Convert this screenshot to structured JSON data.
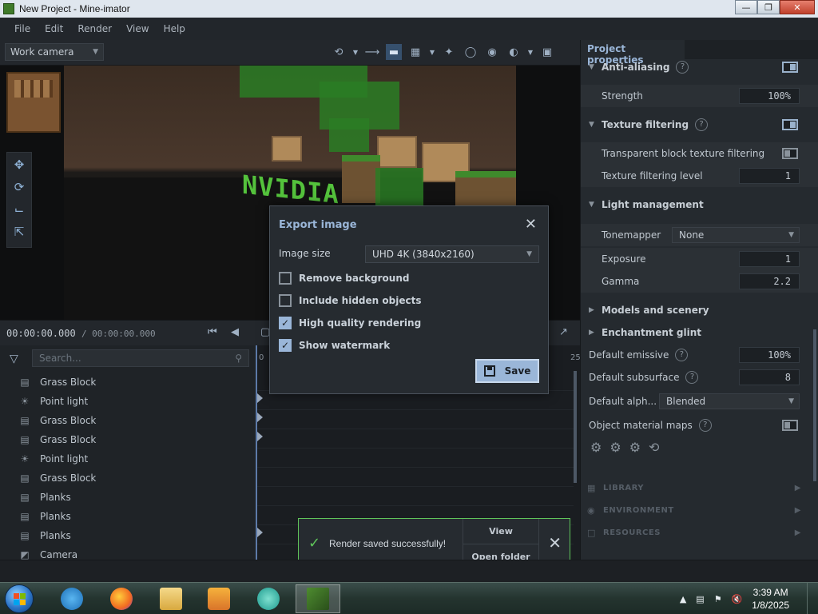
{
  "window": {
    "title": "New Project - Mine-imator"
  },
  "menu": [
    "File",
    "Edit",
    "Render",
    "View",
    "Help"
  ],
  "viewport_toolbar": {
    "camera": "Work camera"
  },
  "viewport": {
    "scene_text": "NVIDIA"
  },
  "timeline": {
    "current_time": "00:00:00.000",
    "total_time": "/ 00:00:00.000",
    "search_placeholder": "Search...",
    "ruler_start": "0",
    "ruler_end": "25",
    "items": [
      {
        "label": "Grass Block",
        "icon": "block-icon"
      },
      {
        "label": "Point light",
        "icon": "light-icon"
      },
      {
        "label": "Grass Block",
        "icon": "block-icon"
      },
      {
        "label": "Grass Block",
        "icon": "block-icon"
      },
      {
        "label": "Point light",
        "icon": "light-icon"
      },
      {
        "label": "Grass Block",
        "icon": "block-icon"
      },
      {
        "label": "Planks",
        "icon": "block-icon"
      },
      {
        "label": "Planks",
        "icon": "block-icon"
      },
      {
        "label": "Planks",
        "icon": "block-icon"
      },
      {
        "label": "Camera",
        "icon": "camera-icon"
      }
    ]
  },
  "properties": {
    "tab": "Project properties",
    "anti_aliasing": "Anti-aliasing",
    "strength_label": "Strength",
    "strength_value": "100%",
    "texture_filtering": "Texture filtering",
    "transparent_filtering": "Transparent block texture filtering",
    "filtering_level_label": "Texture filtering level",
    "filtering_level_value": "1",
    "light_management": "Light management",
    "tonemapper_label": "Tonemapper",
    "tonemapper_value": "None",
    "exposure_label": "Exposure",
    "exposure_value": "1",
    "gamma_label": "Gamma",
    "gamma_value": "2.2",
    "models_scenery": "Models and scenery",
    "enchantment_glint": "Enchantment glint",
    "default_emissive_label": "Default emissive",
    "default_emissive_value": "100%",
    "default_subsurface_label": "Default subsurface",
    "default_subsurface_value": "8",
    "default_alpha_label": "Default alph...",
    "default_alpha_value": "Blended",
    "object_material_maps": "Object material maps",
    "library": "LIBRARY",
    "environment": "ENVIRONMENT",
    "resources": "RESOURCES"
  },
  "dialog": {
    "title": "Export image",
    "image_size_label": "Image size",
    "image_size_value": "UHD 4K (3840x2160)",
    "remove_background": "Remove background",
    "include_hidden": "Include hidden objects",
    "high_quality": "High quality rendering",
    "show_watermark": "Show watermark",
    "save_label": "Save"
  },
  "toast": {
    "message": "Render saved successfully!",
    "view_label": "View",
    "open_folder_label": "Open folder"
  },
  "taskbar": {
    "time": "3:39 AM",
    "date": "1/8/2025"
  }
}
